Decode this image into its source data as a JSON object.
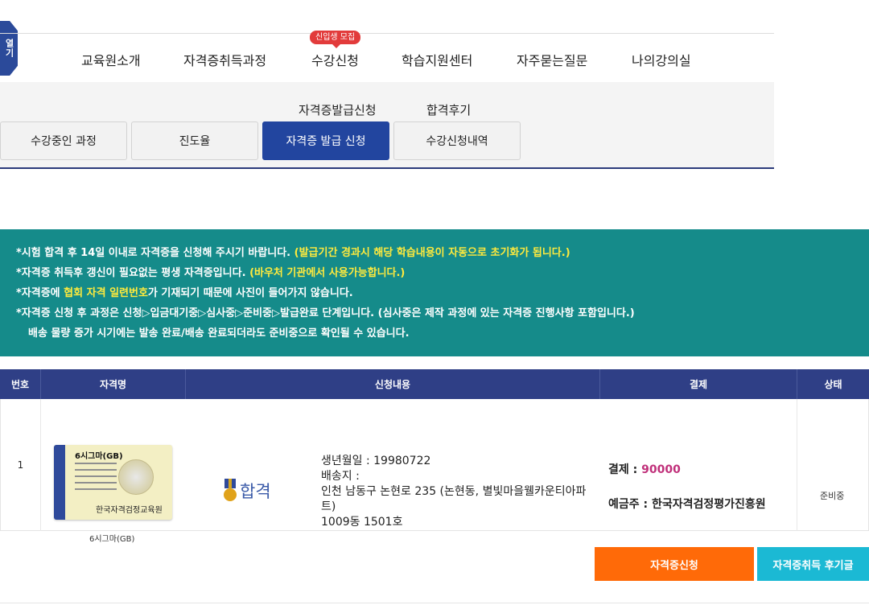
{
  "side_tab": {
    "label": "열기"
  },
  "nav": {
    "items": [
      "교육원소개",
      "자격증취득과정",
      "수강신청",
      "학습지원센터",
      "자주묻는질문",
      "나의강의실"
    ],
    "badge": "신입생 모집"
  },
  "sub_links": [
    "자격증발급신청",
    "합격후기"
  ],
  "tabs": [
    "수강중인 과정",
    "진도율",
    "자격증 발급 신청",
    "수강신청내역"
  ],
  "active_tab_index": 2,
  "notice": {
    "line1_white": "*시험 합격 후 14일 이내로 자격증을 신청해 주시기 바랍니다. ",
    "line1_yellow": "(발급기간 경과시 해당 학습내용이 자동으로 초기화가 됩니다.)",
    "line2_white": "*자격증 취득후 갱신이 필요없는 평생 자격증입니다. ",
    "line2_yellow": "(바우처 기관에서 사용가능합니다.)",
    "line3_pre": "*자격증에 ",
    "line3_yellow": "협회 자격 일련번호",
    "line3_post": "가 기재되기 때문에 사진이 들어가지 않습니다.",
    "line4": "*자격증 신청 후 과정은 신청▷입금대기중▷심사중▷준비중▷발급완료 단계입니다. (심사중은 제작 과정에 있는 자격증 진행사항 포함입니다.)",
    "line5": "배송 물량 증가 시기에는 발송 완료/배송 완료되더라도 준비중으로 확인될 수 있습니다."
  },
  "table": {
    "headers": [
      "번호",
      "자격명",
      "신청내용",
      "결제",
      "상태"
    ],
    "row": {
      "number": "1",
      "cert_card": {
        "title": "6시그마(GB)",
        "org": "한국자격검정교육원"
      },
      "cert_name": "6시그마(GB)",
      "result": "합격",
      "birth": "생년월일 : 19980722",
      "address_label": "배송지 :",
      "address": "인천 남동구 논현로 235 (논현동, 별빛마을웰카운티아파트)",
      "address_detail": "1009동 1501호",
      "payment_label": "결제 : ",
      "payment_amount": "90000",
      "depositor": "예금주 : 한국자격검정평가진흥원",
      "status": "준비중"
    }
  },
  "buttons": {
    "apply": "자격증신청",
    "review": "자격증취득 후기글"
  },
  "colors": {
    "accent": "#22459f",
    "notice_bg": "#158b8a",
    "header_bg": "#2f3f86",
    "orange": "#ff6a08",
    "cyan": "#1bb9d4"
  }
}
